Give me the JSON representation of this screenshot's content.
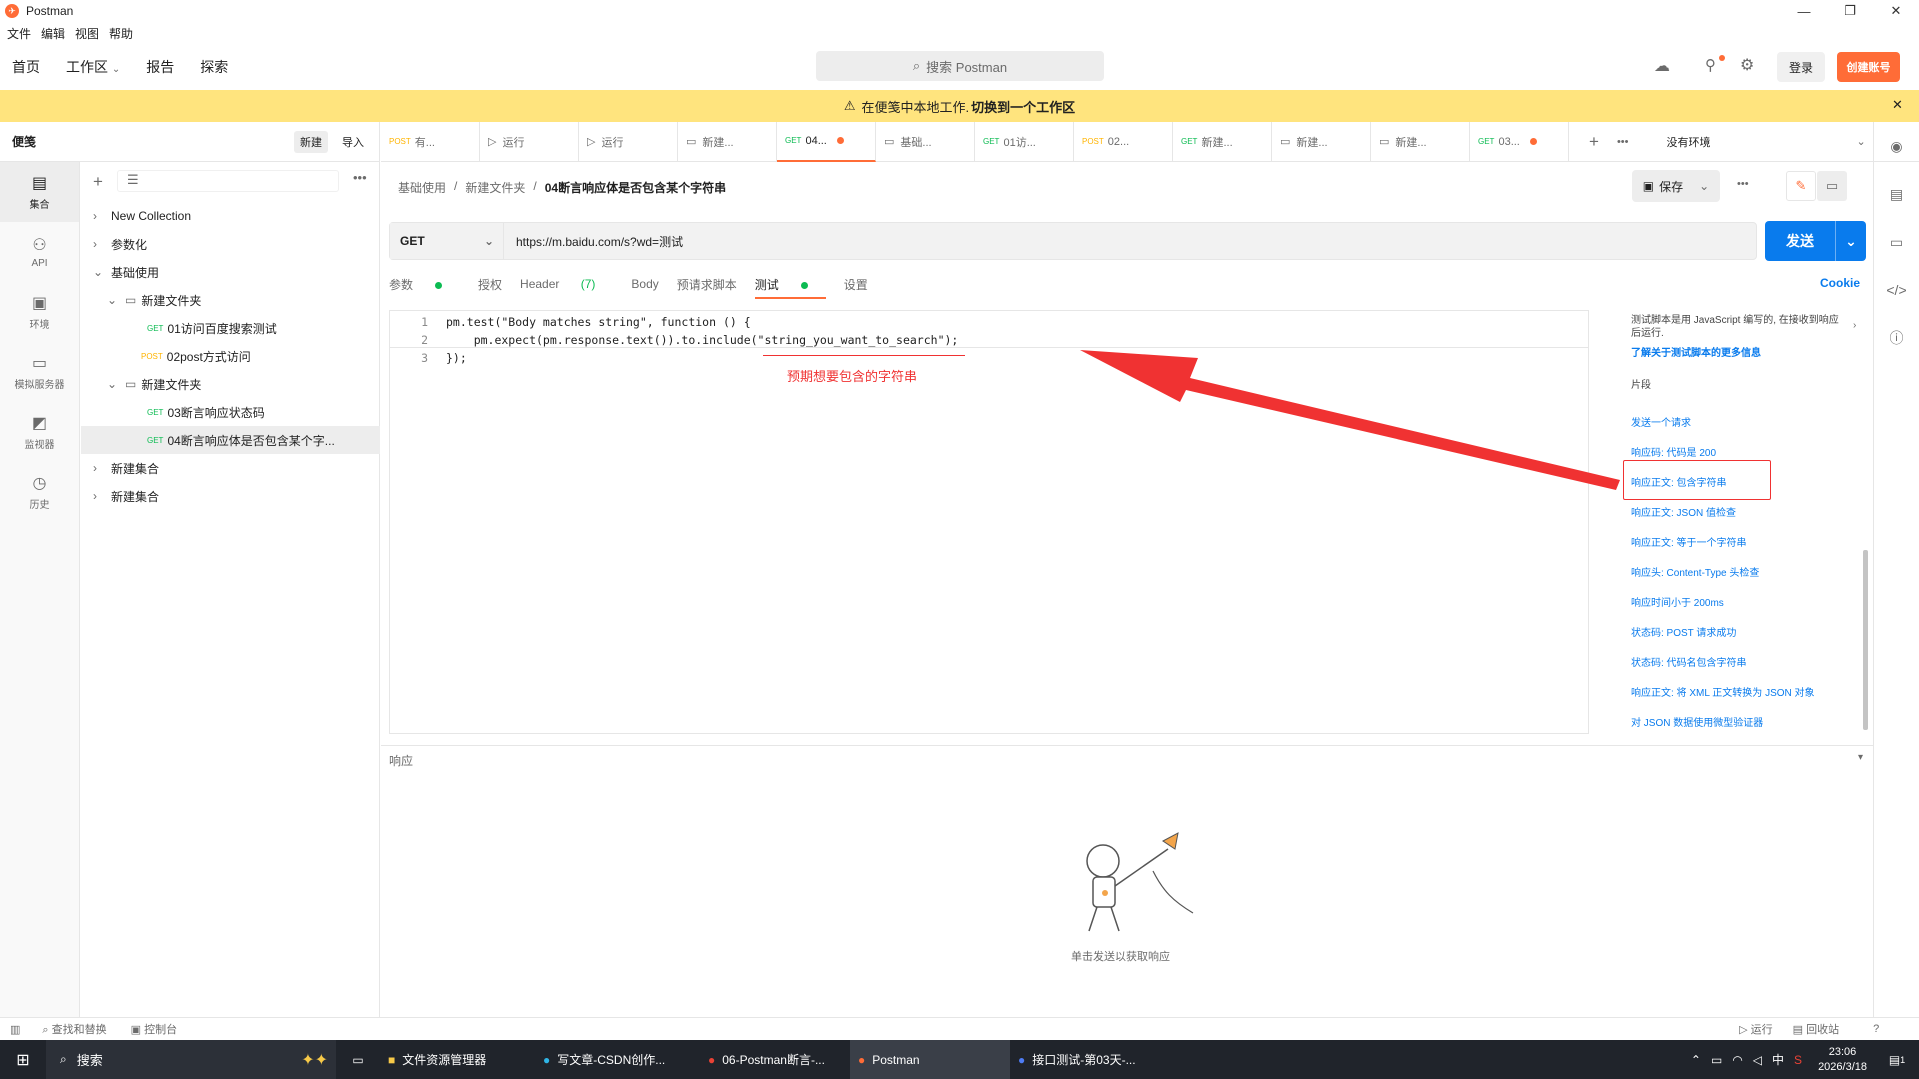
{
  "window": {
    "title": "Postman",
    "minimize": "—",
    "restore": "❐",
    "close": "✕"
  },
  "menu": [
    "文件",
    "编辑",
    "视图",
    "帮助"
  ],
  "appbar": {
    "nav": [
      "首页",
      "工作区",
      "报告",
      "探索"
    ],
    "search_placeholder": "搜索 Postman",
    "login": "登录",
    "create_account": "创建账号"
  },
  "banner": {
    "text": "在便笺中本地工作. ",
    "link": "切换到一个工作区"
  },
  "sidebar": {
    "title": "便笺",
    "new_btn": "新建",
    "import_btn": "导入",
    "nav": [
      {
        "label": "集合",
        "icon": "▤"
      },
      {
        "label": "API",
        "icon": "⚇"
      },
      {
        "label": "环境",
        "icon": "▣"
      },
      {
        "label": "模拟服务器",
        "icon": "▭"
      },
      {
        "label": "监视器",
        "icon": "◩"
      },
      {
        "label": "历史",
        "icon": "◷"
      }
    ],
    "tree": [
      {
        "label": "New Collection"
      },
      {
        "label": "参数化"
      },
      {
        "label": "基础使用"
      },
      {
        "label": "新建文件夹"
      },
      {
        "method": "GET",
        "label": "01访问百度搜索测试"
      },
      {
        "method": "POST",
        "label": "02post方式访问"
      },
      {
        "label": "新建文件夹"
      },
      {
        "method": "GET",
        "label": "03断言响应状态码"
      },
      {
        "method": "GET",
        "label": "04断言响应体是否包含某个字..."
      },
      {
        "label": "新建集合"
      },
      {
        "label": "新建集合"
      }
    ]
  },
  "tabs": [
    {
      "method": "POST",
      "label": "有..."
    },
    {
      "method": "",
      "label": "运行"
    },
    {
      "method": "",
      "label": "运行"
    },
    {
      "method": "",
      "label": "新建..."
    },
    {
      "method": "GET",
      "label": "04..."
    },
    {
      "method": "",
      "label": "基础..."
    },
    {
      "method": "GET",
      "label": "01访..."
    },
    {
      "method": "POST",
      "label": "02..."
    },
    {
      "method": "GET",
      "label": "新建..."
    },
    {
      "method": "",
      "label": "新建..."
    },
    {
      "method": "",
      "label": "新建..."
    },
    {
      "method": "GET",
      "label": "03..."
    }
  ],
  "env": "没有环境",
  "breadcrumb": {
    "a": "基础使用",
    "b": "新建文件夹",
    "c": "04断言响应体是否包含某个字符串"
  },
  "save": "保存",
  "request": {
    "method": "GET",
    "url": "https://m.baidu.com/s?wd=测试",
    "send": "发送",
    "tabs": [
      "参数",
      "授权",
      "Header",
      "(7)",
      "Body",
      "预请求脚本",
      "测试",
      "设置"
    ],
    "cookie": "Cookie"
  },
  "code": {
    "line1": "pm.test(\"Body matches string\", function () {",
    "line2": "    pm.expect(pm.response.text()).to.include(\"string_you_want_to_search\");",
    "line3": "});",
    "annotation": "预期想要包含的字符串"
  },
  "snippets": {
    "intro": "测试脚本是用 JavaScript 编写的, 在接收到响应后运行.",
    "learn_more": "了解关于测试脚本的更多信息",
    "header": "片段",
    "items": [
      "发送一个请求",
      "响应码: 代码是 200",
      "响应正文: 包含字符串",
      "响应正文: JSON 值检查",
      "响应正文: 等于一个字符串",
      "响应头: Content-Type 头检查",
      "响应时间小于 200ms",
      "状态码: POST 请求成功",
      "状态码: 代码名包含字符串",
      "响应正文: 将 XML 正文转换为 JSON 对象",
      "对 JSON 数据使用微型验证器"
    ]
  },
  "response": {
    "title": "响应",
    "empty": "单击发送以获取响应"
  },
  "statusbar": {
    "find": "查找和替换",
    "console": "控制台",
    "run": "运行",
    "trash": "回收站"
  },
  "taskbar": {
    "search": "搜索",
    "items": [
      "文件资源管理器",
      "写文章-CSDN创作...",
      "06-Postman断言-...",
      "Postman",
      "接口测试-第03天-..."
    ],
    "ime": "中",
    "time": "23:06",
    "date": "2026/3/18",
    "notify": "1"
  },
  "colors": {
    "accent": "#ff6c37",
    "send": "#097bed",
    "banner": "#ffe47e",
    "arrow": "#f03232"
  }
}
